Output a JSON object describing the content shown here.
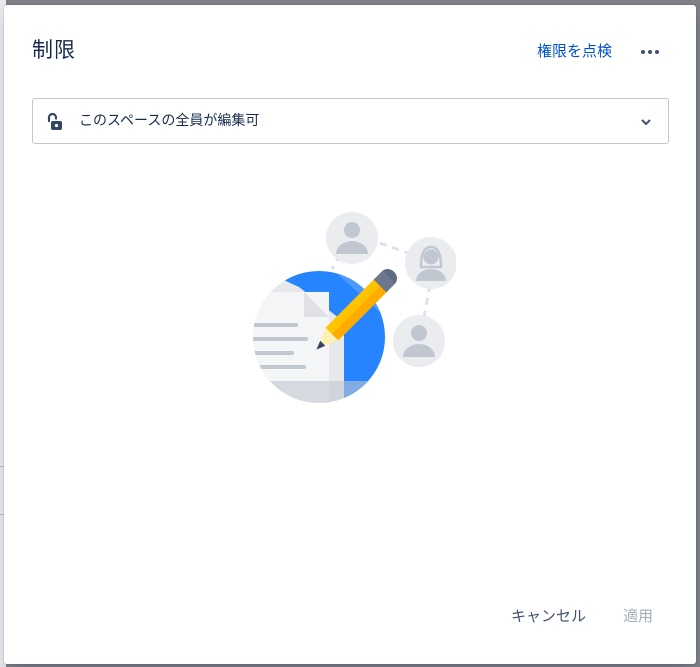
{
  "dialog": {
    "title": "制限",
    "check_permissions_label": "権限を点検",
    "more_actions_icon": "more-horizontal-icon"
  },
  "restriction_select": {
    "icon": "unlock-icon",
    "selected_value": "このスペースの全員が編集可",
    "chevron_icon": "chevron-down-icon"
  },
  "illustration": {
    "name": "edit-permission-illustration"
  },
  "footer": {
    "cancel_label": "キャンセル",
    "apply_label": "適用"
  },
  "colors": {
    "primary_link": "#0052cc",
    "text": "#172b4d",
    "secondary_text": "#42526e",
    "disabled_text": "#a5adba",
    "backdrop": "#7f8187"
  }
}
